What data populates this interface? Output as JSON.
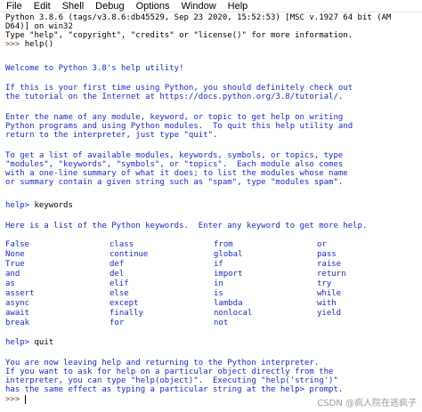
{
  "menu": [
    "File",
    "Edit",
    "Shell",
    "Debug",
    "Options",
    "Window",
    "Help"
  ],
  "header": [
    "Python 3.8.6 (tags/v3.8.6:db45529, Sep 23 2020, 15:52:53) [MSC v.1927 64 bit (AM",
    "D64)] on win32",
    "Type \"help\", \"copyright\", \"credits\" or \"license()\" for more information."
  ],
  "prompt": ">>> ",
  "cmd1": "help()",
  "welcome": "Welcome to Python 3.8's help utility!",
  "para1": [
    "If this is your first time using Python, you should definitely check out",
    "the tutorial on the Internet at https://docs.python.org/3.8/tutorial/."
  ],
  "para2": [
    "Enter the name of any module, keyword, or topic to get help on writing",
    "Python programs and using Python modules.  To quit this help utility and",
    "return to the interpreter, just type \"quit\"."
  ],
  "para3": [
    "To get a list of available modules, keywords, symbols, or topics, type",
    "\"modules\", \"keywords\", \"symbols\", or \"topics\".  Each module also comes",
    "with a one-line summary of what it does; to list the modules whose name",
    "or summary contain a given string such as \"spam\", type \"modules spam\"."
  ],
  "help_prompt": "help> ",
  "cmd2": "keywords",
  "kw_intro": "Here is a list of the Python keywords.  Enter any keyword to get more help.",
  "keywords": [
    [
      "False",
      "class",
      "from",
      "or"
    ],
    [
      "None",
      "continue",
      "global",
      "pass"
    ],
    [
      "True",
      "def",
      "if",
      "raise"
    ],
    [
      "and",
      "del",
      "import",
      "return"
    ],
    [
      "as",
      "elif",
      "in",
      "try"
    ],
    [
      "assert",
      "else",
      "is",
      "while"
    ],
    [
      "async",
      "except",
      "lambda",
      "with"
    ],
    [
      "await",
      "finally",
      "nonlocal",
      "yield"
    ],
    [
      "break",
      "for",
      "not",
      ""
    ]
  ],
  "cmd3": "quit",
  "leaving": [
    "You are now leaving help and returning to the Python interpreter.",
    "If you want to ask for help on a particular object directly from the",
    "interpreter, you can type \"help(object)\".  Executing \"help('string')\"",
    "has the same effect as typing a particular string at the help> prompt."
  ],
  "final_prompt": ">>>",
  "watermark": "CSDN @疯人院在逃疯子",
  "colors": {
    "output": "#1a2bd1",
    "stdin": "#000000",
    "background": "#ffffff"
  }
}
